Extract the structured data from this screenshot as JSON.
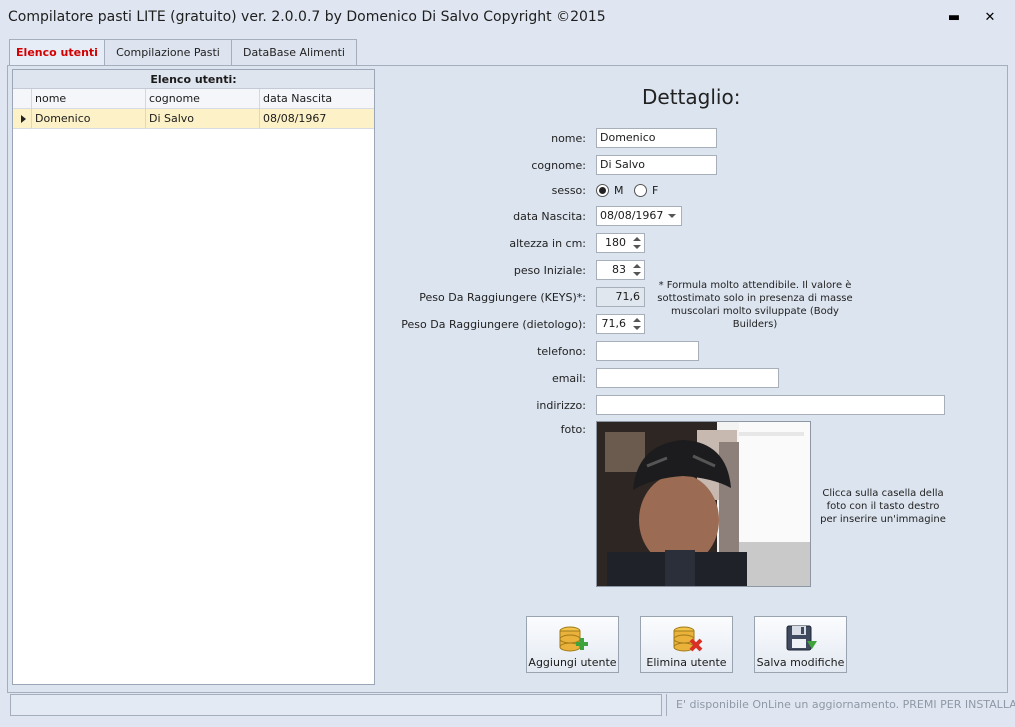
{
  "window": {
    "title": "Compilatore pasti LITE (gratuito) ver. 2.0.0.7  by Domenico Di Salvo Copyright ©2015",
    "minimize_glyph": "▬",
    "close_glyph": "✕"
  },
  "tabs": [
    {
      "label": "Elenco utenti",
      "active": true
    },
    {
      "label": "Compilazione Pasti",
      "active": false
    },
    {
      "label": "DataBase Alimenti",
      "active": false
    }
  ],
  "user_grid": {
    "caption": "Elenco utenti:",
    "columns": [
      "nome",
      "cognome",
      "data Nascita"
    ],
    "rows": [
      {
        "nome": "Domenico",
        "cognome": "Di Salvo",
        "data_nascita": "08/08/1967",
        "selected": true
      }
    ]
  },
  "detail": {
    "title": "Dettaglio:",
    "labels": {
      "nome": "nome:",
      "cognome": "cognome:",
      "sesso": "sesso:",
      "data_nascita": "data Nascita:",
      "altezza": "altezza in cm:",
      "peso_iniziale": "peso Iniziale:",
      "peso_keys": "Peso Da Raggiungere (KEYS)*:",
      "peso_dietologo": "Peso Da Raggiungere (dietologo):",
      "telefono": "telefono:",
      "email": "email:",
      "indirizzo": "indirizzo:",
      "foto": "foto:"
    },
    "values": {
      "nome": "Domenico",
      "cognome": "Di Salvo",
      "sesso_options": [
        "M",
        "F"
      ],
      "sesso_selected": "M",
      "data_nascita": "08/08/1967",
      "altezza": "180",
      "peso_iniziale": "83",
      "peso_keys": "71,6",
      "peso_dietologo": "71,6",
      "telefono": "",
      "email": "",
      "indirizzo": ""
    },
    "formula_note": "* Formula molto attendibile. Il valore è sottostimato solo in presenza di masse muscolari molto sviluppate (Body Builders)",
    "photo_hint": "Clicca sulla casella della foto con il tasto destro per inserire un'immagine"
  },
  "buttons": {
    "add_user": "Aggiungi utente",
    "delete_user": "Elimina utente",
    "save": "Salva modifiche"
  },
  "status_bar": {
    "update_message": "E' disponibile OnLine un aggiornamento. PREMI PER INSTALLARE"
  },
  "colors": {
    "background": "#dfe6f1",
    "active_tab_text": "#d40000",
    "selected_row": "#fdf1c7",
    "status_text": "#8f98a6"
  },
  "icons": {
    "add_user": "database-add-icon",
    "delete_user": "database-delete-icon",
    "save": "floppy-disk-save-icon",
    "row_pointer": "row-pointer-icon"
  }
}
